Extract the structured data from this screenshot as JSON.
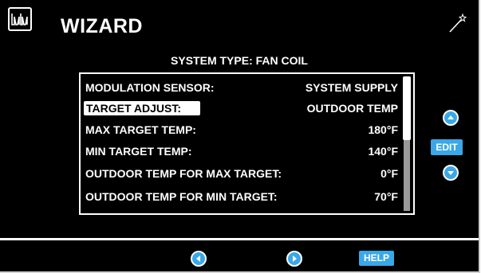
{
  "header": {
    "title": "WIZARD",
    "logo_text": "WM"
  },
  "system_type_label": "SYSTEM TYPE: FAN COIL",
  "settings": [
    {
      "label": "MODULATION SENSOR:",
      "value": "SYSTEM SUPPLY",
      "selected": false
    },
    {
      "label": "TARGET ADJUST:",
      "value": "OUTDOOR TEMP",
      "selected": true
    },
    {
      "label": "MAX TARGET TEMP:",
      "value": "180°F",
      "selected": false
    },
    {
      "label": "MIN TARGET TEMP:",
      "value": "140°F",
      "selected": false
    },
    {
      "label": "OUTDOOR TEMP FOR MAX TARGET:",
      "value": "0°F",
      "selected": false
    },
    {
      "label": "OUTDOOR TEMP FOR MIN TARGET:",
      "value": "70°F",
      "selected": false
    }
  ],
  "side_controls": {
    "edit_label": "EDIT"
  },
  "footer": {
    "help_label": "HELP"
  },
  "icons": {
    "wand": "wand-icon",
    "up": "chevron-up-icon",
    "down": "chevron-down-icon",
    "left": "chevron-left-icon",
    "right": "chevron-right-icon"
  },
  "colors": {
    "background": "#000000",
    "accent": "#3aa8e8",
    "text": "#ffffff"
  }
}
